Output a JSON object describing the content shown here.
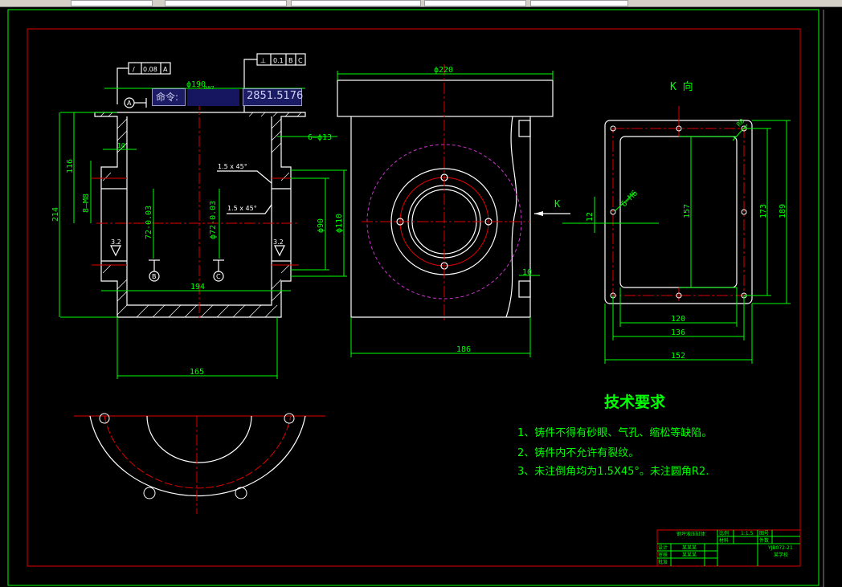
{
  "window": {
    "toolbar_segments": 6
  },
  "command_tooltip": {
    "label": "命令:",
    "input_value": "",
    "coordinate": "2851.5176"
  },
  "colors": {
    "background": "#000000",
    "dimension": "#00ff00",
    "outline": "#ffffff",
    "centerline": "#e00000",
    "frame_border": "#e00000",
    "sheet_border": "#00ff00"
  },
  "section_view": {
    "tolerance_1": {
      "symbol": "/",
      "value": "0.08",
      "datum": "A"
    },
    "tolerance_2": {
      "symbol": "⊥",
      "value": "0.1",
      "datum1": "B",
      "datum2": "C"
    },
    "datum_a": "A",
    "datum_b": "B",
    "datum_c": "C",
    "dims": {
      "dia190": "ϕ190",
      "dia190_fit": "D87",
      "d10": "10",
      "holes6": "6–ϕ13",
      "d116": "116",
      "m8": "8–M8",
      "d214": "214",
      "chamfer1": "1.5 x 45°",
      "chamfer2": "1.5 x 45°",
      "d72": "72-0.03",
      "d72b": "ϕ72-0.03",
      "dia90": "ϕ90",
      "dia110": "ϕ110",
      "rough1": "3.2",
      "rough2": "3.2",
      "d194": "194",
      "d165": "165"
    }
  },
  "front_view": {
    "dims": {
      "dia220": "ϕ220",
      "d12": "12",
      "d10": "10",
      "d186": "186",
      "arrow_k": "K"
    }
  },
  "k_view": {
    "title": "K 向",
    "dims": {
      "m6": "6–M6",
      "r8": "R8",
      "d157": "157",
      "d173": "173",
      "d189": "189",
      "d120": "120",
      "d136": "136",
      "d152": "152"
    }
  },
  "tech_requirements": {
    "title": "技术要求",
    "items": [
      "1、铸件不得有砂眼、气孔、缩松等缺陷。",
      "2、铸件内不允许有裂纹。",
      "3、未注倒角均为1.5X45°。未注圆角R2."
    ]
  },
  "title_block": {
    "name": "钢坪液压缸体",
    "scale_label": "比例",
    "scale": "1:1.5",
    "sheet_label": "图号",
    "quantity_label": "件数",
    "material_label": "材料",
    "designer_label": "设计",
    "checker_label": "审核",
    "approver_label": "批准",
    "drawing_no": "YJB072-21",
    "company": "某学校",
    "designer": "某某某",
    "checker": "某某某"
  }
}
